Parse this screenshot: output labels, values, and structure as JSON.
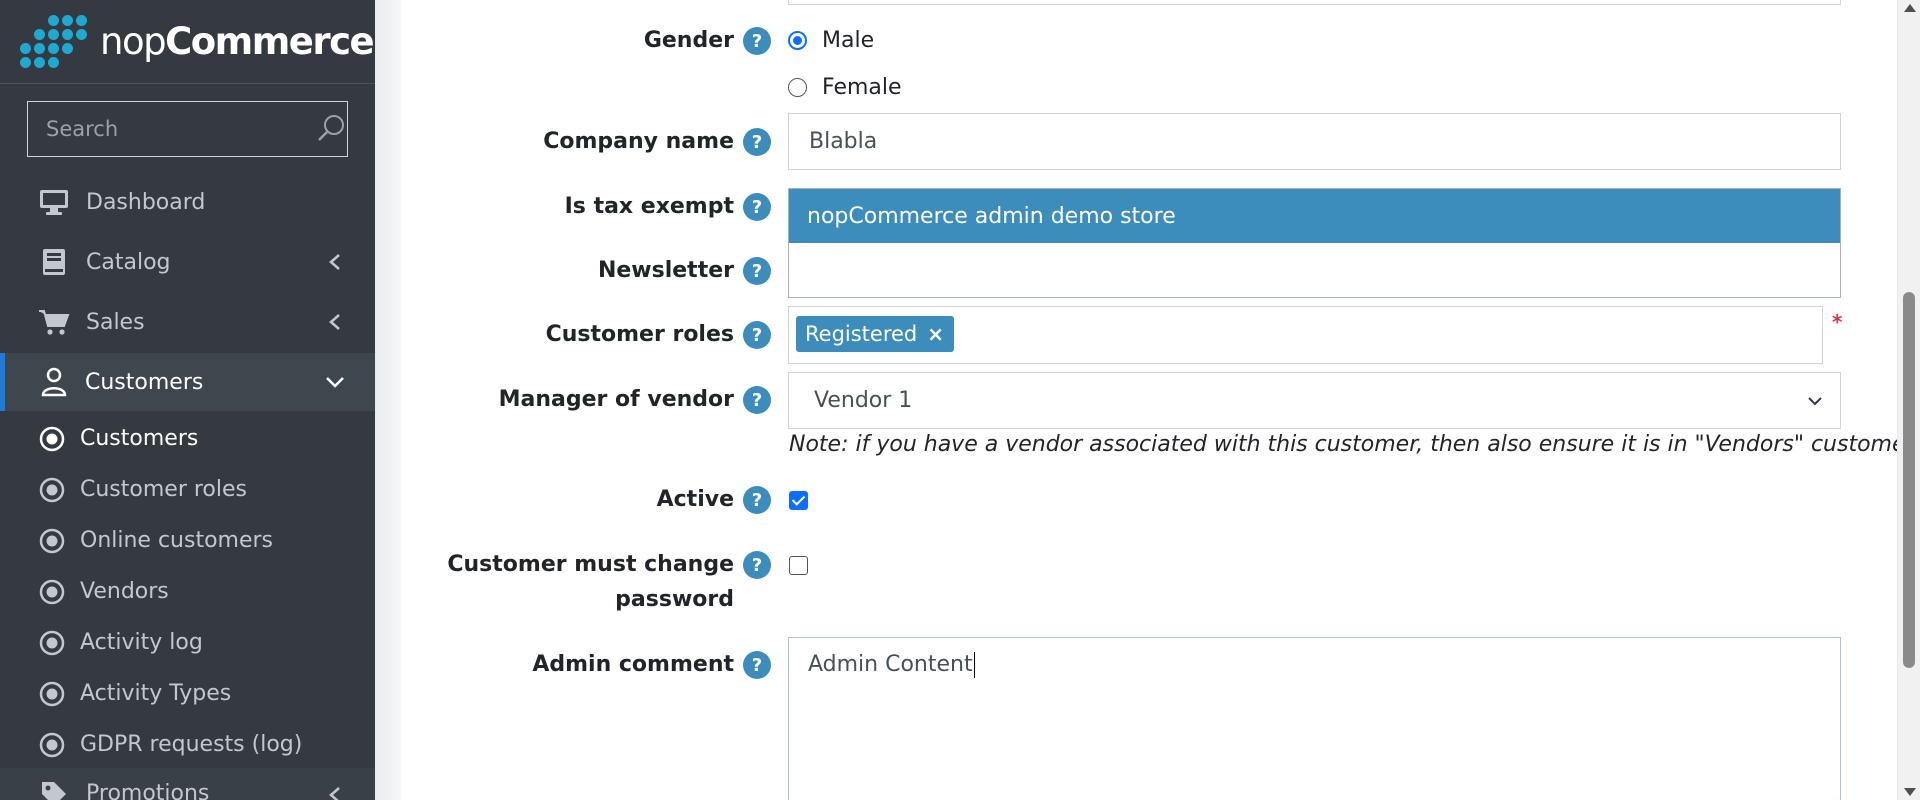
{
  "brand": {
    "name_light": "nop",
    "name_bold": "Commerce"
  },
  "search": {
    "placeholder": "Search"
  },
  "sidebar": {
    "items": [
      {
        "label": "Dashboard",
        "icon": "desktop-icon"
      },
      {
        "label": "Catalog",
        "icon": "book-icon"
      },
      {
        "label": "Sales",
        "icon": "cart-icon"
      },
      {
        "label": "Customers",
        "icon": "user-icon"
      }
    ],
    "sub_items": [
      {
        "label": "Customers"
      },
      {
        "label": "Customer roles"
      },
      {
        "label": "Online customers"
      },
      {
        "label": "Vendors"
      },
      {
        "label": "Activity log"
      },
      {
        "label": "Activity Types"
      },
      {
        "label": "GDPR requests (log)"
      }
    ],
    "next_item": {
      "label": "Promotions"
    }
  },
  "form": {
    "help_glyph": "?",
    "gender": {
      "label": "Gender",
      "options": [
        "Male",
        "Female"
      ],
      "selected": "Male"
    },
    "company_name": {
      "label": "Company name",
      "value": "Blabla"
    },
    "is_tax_exempt": {
      "label": "Is tax exempt"
    },
    "newsletter": {
      "label": "Newsletter",
      "highlighted_option": "nopCommerce admin demo store"
    },
    "customer_roles": {
      "label": "Customer roles",
      "tags": [
        "Registered"
      ],
      "remove_glyph": "×",
      "required_mark": "*"
    },
    "manager_of_vendor": {
      "label": "Manager of vendor",
      "value": "Vendor 1",
      "note": "Note: if you have a vendor associated with this customer, then also ensure it is in \"Vendors\" customer role."
    },
    "active": {
      "label": "Active",
      "checked": true
    },
    "must_change_password": {
      "label_line1": "Customer must change",
      "label_line2": "password",
      "checked": false
    },
    "admin_comment": {
      "label": "Admin comment",
      "value": "Admin Content"
    }
  },
  "colors": {
    "sidebar_bg": "#343a40",
    "accent": "#3c8dbc",
    "active_border": "#1e7bd8",
    "required": "#dc3545"
  }
}
